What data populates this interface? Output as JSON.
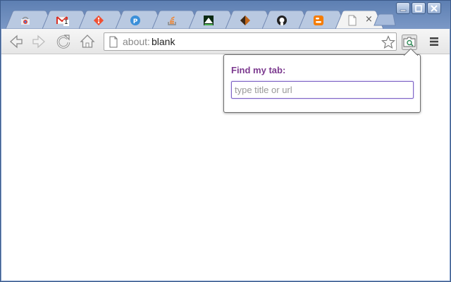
{
  "browser": {
    "tabs": [
      {
        "icon": "chrome-webstore-icon",
        "title": "",
        "color": "#e8a64a"
      },
      {
        "icon": "gmail-icon",
        "title": "",
        "badge": "1",
        "color": "#d93025"
      },
      {
        "icon": "git-icon",
        "title": "",
        "color": "#f05033"
      },
      {
        "icon": "pandora-icon",
        "title": "",
        "color": "#3668ff"
      },
      {
        "icon": "stackoverflow-icon",
        "title": "",
        "color": "#f48024"
      },
      {
        "icon": "mountain-icon",
        "title": "",
        "color": "#1b5e20"
      },
      {
        "icon": "diamond-icon",
        "title": "",
        "color": "#c2661a"
      },
      {
        "icon": "github-icon",
        "title": "",
        "color": "#333333"
      },
      {
        "icon": "blogger-icon",
        "title": "",
        "color": "#f57c00"
      },
      {
        "icon": "blank-page-icon",
        "title": "",
        "active": true,
        "close": "×"
      }
    ],
    "omnibox": {
      "scheme": "about:",
      "rest": "blank"
    }
  },
  "popup": {
    "title": "Find my tab:",
    "input_placeholder": "type title or url",
    "input_value": ""
  },
  "colors": {
    "frame": "#6d8cbf",
    "popup_title": "#7c3a8f",
    "input_border": "#7d63c4"
  }
}
